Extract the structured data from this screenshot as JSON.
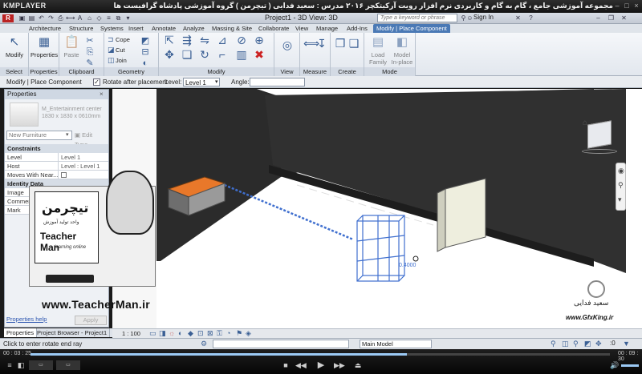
{
  "player": {
    "logo": "KMPLAYER",
    "title": "مجموعه آموزشی جامع ، گام به گام و کاربردی نرم افزار رویت آرکیتکچر ۲۰۱۶   مدرس : سعید فدایی ( تیچرمن ) گروه آموزشی پادشاه گرافیست ها",
    "time_current": "00 : 03 : 25",
    "time_total": "00 : 09 : 30",
    "progress": 0.65
  },
  "app": {
    "title": "Project1 - 3D View: 3D",
    "search_placeholder": "Type a keyword or phrase",
    "signin": "Sign In"
  },
  "tabs": [
    "Architecture",
    "Structure",
    "Systems",
    "Insert",
    "Annotate",
    "Analyze",
    "Massing & Site",
    "Collaborate",
    "View",
    "Manage",
    "Add-Ins",
    "Modify | Place Component"
  ],
  "ribbon": {
    "modify_label": "Modify",
    "properties_label": "Properties",
    "paste_label": "Paste",
    "cope_label": "Cope",
    "cut_label": "Cut",
    "join_label": "Join",
    "load_family_label": "Load Family",
    "model_inplace_label": "Model In-place",
    "panels": [
      "Select",
      "Properties",
      "Clipboard",
      "Geometry",
      "Modify",
      "View",
      "Measure",
      "Create",
      "Mode"
    ]
  },
  "options_bar": {
    "context": "Modify | Place Component",
    "rotate_label": "Rotate after placement",
    "level_label": "Level:",
    "level_value": "Level 1",
    "angle_label": "Angle:"
  },
  "properties": {
    "header": "Properties",
    "type_name": "M_Entertainment center\n1830 x 1830 x 0610mm",
    "filter": "New Furniture",
    "edit_type": "Edit Type",
    "sections": [
      "Constraints",
      "Identity Data"
    ],
    "rows": [
      {
        "k": "Level",
        "v": "Level 1"
      },
      {
        "k": "Host",
        "v": "Level : Level 1"
      },
      {
        "k": "Moves With Near...",
        "v": ""
      },
      {
        "k": "Image",
        "v": ""
      },
      {
        "k": "Comments",
        "v": ""
      },
      {
        "k": "Mark",
        "v": ""
      }
    ],
    "help": "Properties help",
    "apply": "Apply"
  },
  "bottom_tabs": [
    "Properties",
    "Project Browser - Project1"
  ],
  "view": {
    "scale": "1 : 100",
    "dimension": "0.4000"
  },
  "status": {
    "text": "Click to enter rotate end ray",
    "model": "Main Model",
    "zero": ":0"
  },
  "watermark": {
    "brand_fa": "تیچرمن",
    "brand_sub_fa": "واحد تولید آموزش",
    "brand_en": "Teacher Man",
    "brand_tag": "learning online",
    "url": "www.TeacherMan.ir",
    "gfx_author": "سعید فدایی",
    "gfx_url": "www.GfxKing.ir"
  },
  "colors": {
    "tab_active": "#4a79b5",
    "wall": "#2c2c2c",
    "selection": "#3f6fcf",
    "desk_top": "#e8782a"
  }
}
